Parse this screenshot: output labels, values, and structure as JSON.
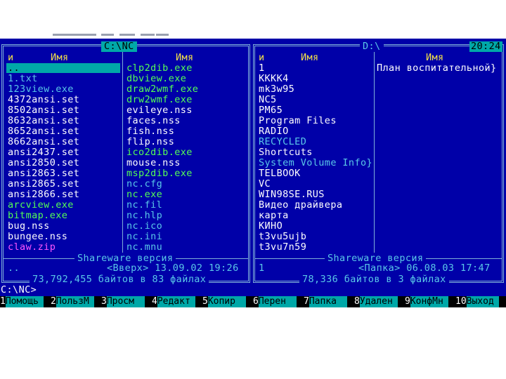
{
  "left_panel": {
    "path": "C:\\NC",
    "col_headers": [
      "и",
      "Имя",
      "Имя"
    ],
    "col1": [
      {
        "name": "..",
        "color": "selected"
      },
      {
        "name": "1.txt",
        "color": "cyan"
      },
      {
        "name": "123view.exe",
        "color": "cyan"
      },
      {
        "name": "4372ansi.set",
        "color": "white"
      },
      {
        "name": "8502ansi.set",
        "color": "white"
      },
      {
        "name": "8632ansi.set",
        "color": "white"
      },
      {
        "name": "8652ansi.set",
        "color": "white"
      },
      {
        "name": "8662ansi.set",
        "color": "white"
      },
      {
        "name": "ansi2437.set",
        "color": "white"
      },
      {
        "name": "ansi2850.set",
        "color": "white"
      },
      {
        "name": "ansi2863.set",
        "color": "white"
      },
      {
        "name": "ansi2865.set",
        "color": "white"
      },
      {
        "name": "ansi2866.set",
        "color": "white"
      },
      {
        "name": "arcview.exe",
        "color": "green"
      },
      {
        "name": "bitmap.exe",
        "color": "green"
      },
      {
        "name": "bug.nss",
        "color": "white"
      },
      {
        "name": "bungee.nss",
        "color": "white"
      },
      {
        "name": "claw.zip",
        "color": "pink"
      }
    ],
    "col2": [
      {
        "name": "clp2dib.exe",
        "color": "green"
      },
      {
        "name": "dbview.exe",
        "color": "green"
      },
      {
        "name": "draw2wmf.exe",
        "color": "green"
      },
      {
        "name": "drw2wmf.exe",
        "color": "green"
      },
      {
        "name": "evileye.nss",
        "color": "white"
      },
      {
        "name": "faces.nss",
        "color": "white"
      },
      {
        "name": "fish.nss",
        "color": "white"
      },
      {
        "name": "flip.nss",
        "color": "white"
      },
      {
        "name": "ico2dib.exe",
        "color": "green"
      },
      {
        "name": "mouse.nss",
        "color": "white"
      },
      {
        "name": "msp2dib.exe",
        "color": "green"
      },
      {
        "name": "nc.cfg",
        "color": "cyan"
      },
      {
        "name": "nc.exe",
        "color": "green"
      },
      {
        "name": "nc.fil",
        "color": "cyan"
      },
      {
        "name": "nc.hlp",
        "color": "cyan"
      },
      {
        "name": "nc.ico",
        "color": "cyan"
      },
      {
        "name": "nc.ini",
        "color": "cyan"
      },
      {
        "name": "nc.mnu",
        "color": "cyan"
      }
    ],
    "footer_caption": "Shareware версия",
    "status_name": "..",
    "status_info": "<Вверх> 13.09.02 19:26",
    "summary": "73,792,455 байтов в 83 файлах"
  },
  "right_panel": {
    "path": "D:\\",
    "clock": "20:24",
    "col_headers": [
      "и",
      "Имя",
      "Имя"
    ],
    "col1": [
      {
        "name": "1",
        "color": "white"
      },
      {
        "name": "KKKK4",
        "color": "white"
      },
      {
        "name": "mk3w95",
        "color": "white"
      },
      {
        "name": "NC5",
        "color": "white"
      },
      {
        "name": "PM65",
        "color": "white"
      },
      {
        "name": "Program Files",
        "color": "white"
      },
      {
        "name": "RADIO",
        "color": "white"
      },
      {
        "name": "RECYCLED",
        "color": "cyan"
      },
      {
        "name": "Shortcuts",
        "color": "white"
      },
      {
        "name": "System Volume Info}",
        "color": "cyan"
      },
      {
        "name": "TELBOOK",
        "color": "white"
      },
      {
        "name": "VC",
        "color": "white"
      },
      {
        "name": "WIN98SE.RUS",
        "color": "white"
      },
      {
        "name": "Видео драйвера",
        "color": "white"
      },
      {
        "name": "карта",
        "color": "white"
      },
      {
        "name": "КИНО",
        "color": "white"
      },
      {
        "name": "t3vu5ujb",
        "color": "white"
      },
      {
        "name": "t3vu7n59",
        "color": "white"
      }
    ],
    "col2": [
      {
        "name": "План воспитательной}",
        "color": "white"
      }
    ],
    "footer_caption": "Shareware версия",
    "status_name": "1",
    "status_info": "<Папка> 06.08.03 17:47",
    "summary": "78,336 байтов в 3 файлах"
  },
  "command_line": "C:\\NC>",
  "function_keys": [
    {
      "num": "1",
      "label": "Помощь"
    },
    {
      "num": "2",
      "label": "ПользМ"
    },
    {
      "num": "3",
      "label": "Просм"
    },
    {
      "num": "4",
      "label": "Редакт"
    },
    {
      "num": "5",
      "label": "Копир"
    },
    {
      "num": "6",
      "label": "Перен"
    },
    {
      "num": "7",
      "label": "Папка"
    },
    {
      "num": "8",
      "label": "Удален"
    },
    {
      "num": "9",
      "label": "КонфМн"
    },
    {
      "num": "10",
      "label": "Выход"
    }
  ],
  "colors": {
    "background": "#0000a8",
    "border": "#7fb0d8",
    "header": "#f2e04a",
    "selection": "#00a8a8",
    "fkey_label_bg": "#00a8a8"
  }
}
